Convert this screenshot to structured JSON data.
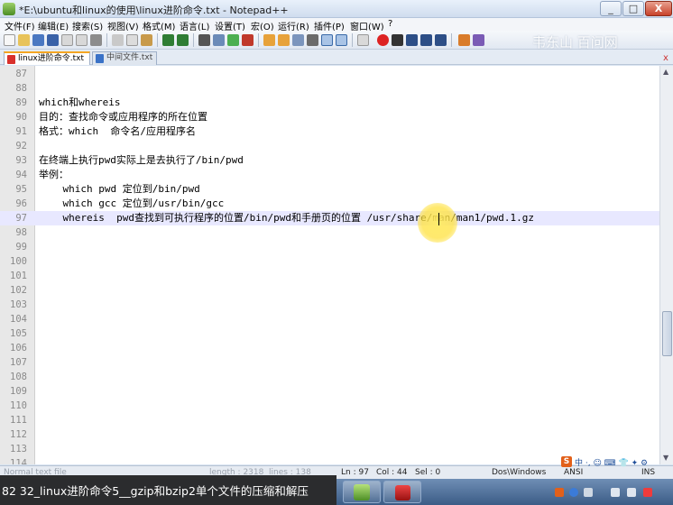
{
  "window": {
    "title": "*E:\\ubuntu和linux的使用\\linux进阶命令.txt - Notepad++",
    "min_label": "_",
    "max_label": "□",
    "close_label": "X"
  },
  "menu": [
    "文件(F)",
    "编辑(E)",
    "搜索(S)",
    "视图(V)",
    "格式(M)",
    "语言(L)",
    "设置(T)",
    "宏(O)",
    "运行(R)",
    "插件(P)",
    "窗口(W)",
    "?"
  ],
  "toolbar": {
    "watermark": "韦东山  百问网"
  },
  "tabs": [
    {
      "label": "linux进阶命令.txt",
      "active": true
    },
    {
      "label": "中间文件.txt",
      "active": false
    }
  ],
  "tab_close_label": "x",
  "editor": {
    "lines": [
      {
        "num": "87",
        "text": ""
      },
      {
        "num": "88",
        "text": ""
      },
      {
        "num": "89",
        "text": "which和whereis"
      },
      {
        "num": "90",
        "text": "目的：查找命令或应用程序的所在位置"
      },
      {
        "num": "91",
        "text": "格式：which  命令名/应用程序名"
      },
      {
        "num": "92",
        "text": ""
      },
      {
        "num": "93",
        "text": "在终端上执行pwd实际上是去执行了/bin/pwd"
      },
      {
        "num": "94",
        "text": "举例："
      },
      {
        "num": "95",
        "text": "    which pwd 定位到/bin/pwd"
      },
      {
        "num": "96",
        "text": "    which gcc 定位到/usr/bin/gcc"
      },
      {
        "num": "97",
        "text": "    whereis  pwd查找到可执行程序的位置/bin/pwd和手册页的位置 /usr/share/man/man1/pwd.1.gz"
      },
      {
        "num": "98",
        "text": ""
      },
      {
        "num": "99",
        "text": ""
      },
      {
        "num": "100",
        "text": ""
      },
      {
        "num": "101",
        "text": ""
      },
      {
        "num": "102",
        "text": ""
      },
      {
        "num": "103",
        "text": ""
      },
      {
        "num": "104",
        "text": ""
      },
      {
        "num": "105",
        "text": ""
      },
      {
        "num": "106",
        "text": ""
      },
      {
        "num": "107",
        "text": ""
      },
      {
        "num": "108",
        "text": ""
      },
      {
        "num": "109",
        "text": ""
      },
      {
        "num": "110",
        "text": ""
      },
      {
        "num": "111",
        "text": ""
      },
      {
        "num": "112",
        "text": ""
      },
      {
        "num": "113",
        "text": ""
      },
      {
        "num": "114",
        "text": ""
      }
    ],
    "current_line": "97"
  },
  "statusbar": {
    "file_type": "Normal text file",
    "length": "length : 2318",
    "lines": "lines : 138",
    "ln": "Ln : 97",
    "col": "Col : 44",
    "sel": "Sel : 0",
    "eol": "Dos\\Windows",
    "encoding": "ANSI",
    "mode": "INS"
  },
  "caption": "82 32_linux进阶命令5__gzip和bzip2单个文件的压缩和解压",
  "ime": {
    "logo": "S",
    "text": "中 ·, ☺ ⌨ 👕 ✦ ⚙"
  },
  "colors": {
    "accent_tab": "#f5a623",
    "current_line": "#e8e8ff",
    "highlight": "#ffe13c"
  }
}
